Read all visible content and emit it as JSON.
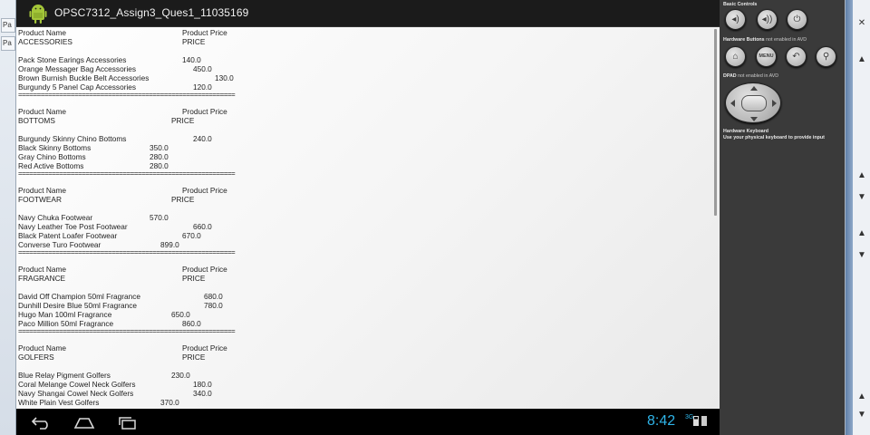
{
  "app": {
    "title": "OPSC7312_Assign3_Ques1_11035169"
  },
  "host_tabs": [
    "Pa",
    "Pa"
  ],
  "sections": [
    {
      "header_name": "Product Name",
      "header_price": "Product Price",
      "category": "ACCESSORIES",
      "price_label": "PRICE",
      "items": [
        {
          "name": "Pack Stone Earings Accessories",
          "price": "140.0"
        },
        {
          "name": "Orange Messager Bag Accessories",
          "price": "450.0"
        },
        {
          "name": "Brown Burnish Buckle Belt Accessories",
          "price": "130.0"
        },
        {
          "name": "Burgundy 5 Panel Cap Accessories",
          "price": "120.0"
        }
      ]
    },
    {
      "header_name": "Product Name",
      "header_price": "Product Price",
      "category": "BOTTOMS",
      "price_label": "PRICE",
      "items": [
        {
          "name": "Burgundy Skinny Chino Bottoms",
          "price": "240.0"
        },
        {
          "name": "Black Skinny Bottoms",
          "price": "350.0"
        },
        {
          "name": "Gray Chino Bottoms",
          "price": "280.0"
        },
        {
          "name": "Red Active Bottoms",
          "price": "280.0"
        }
      ]
    },
    {
      "header_name": "Product Name",
      "header_price": "Product Price",
      "category": "FOOTWEAR",
      "price_label": "PRICE",
      "items": [
        {
          "name": "Navy Chuka Footwear",
          "price": "570.0"
        },
        {
          "name": "Navy Leather Toe Post Footwear",
          "price": "660.0"
        },
        {
          "name": "Black Patent Loafer Footwear",
          "price": "670.0"
        },
        {
          "name": "Converse Turo Footwear",
          "price": "899.0"
        }
      ]
    },
    {
      "header_name": "Product Name",
      "header_price": "Product Price",
      "category": "FRAGRANCE",
      "price_label": "PRICE",
      "items": [
        {
          "name": "David Off Champion 50ml Fragrance",
          "price": "680.0"
        },
        {
          "name": "Dunhill Desire Blue 50ml Fragrance",
          "price": "780.0"
        },
        {
          "name": "Hugo Man 100ml Fragrance",
          "price": "650.0"
        },
        {
          "name": "Paco Million 50ml Fragrance",
          "price": "860.0"
        }
      ]
    },
    {
      "header_name": "Product Name",
      "header_price": "Product Price",
      "category": "GOLFERS",
      "price_label": "PRICE",
      "items": [
        {
          "name": "Blue Relay Pigment Golfers",
          "price": "230.0"
        },
        {
          "name": "Coral Melange Cowel Neck Golfers",
          "price": "180.0"
        },
        {
          "name": "Navy Shangai Cowel Neck Golfers",
          "price": "340.0"
        },
        {
          "name": "White Plain Vest Golfers",
          "price": "370.0"
        }
      ]
    }
  ],
  "separator": "==========================================================",
  "statusbar": {
    "time": "8:42",
    "signal": "3G",
    "time_color": "#2fb4e8"
  },
  "navbar": {
    "back_icon": "back-arrow-icon",
    "home_icon": "home-icon",
    "recents_icon": "recent-apps-icon"
  },
  "controls": {
    "basic_label": "Basic Controls",
    "hardware_buttons_label": "Hardware Buttons",
    "hardware_buttons_note": "not enabled in AVD",
    "dpad_label": "DPAD",
    "dpad_note": "not enabled in AVD",
    "keyboard_label": "Hardware Keyboard",
    "keyboard_note": "Use your physical keyboard to provide input",
    "menu_label": "MENU"
  }
}
